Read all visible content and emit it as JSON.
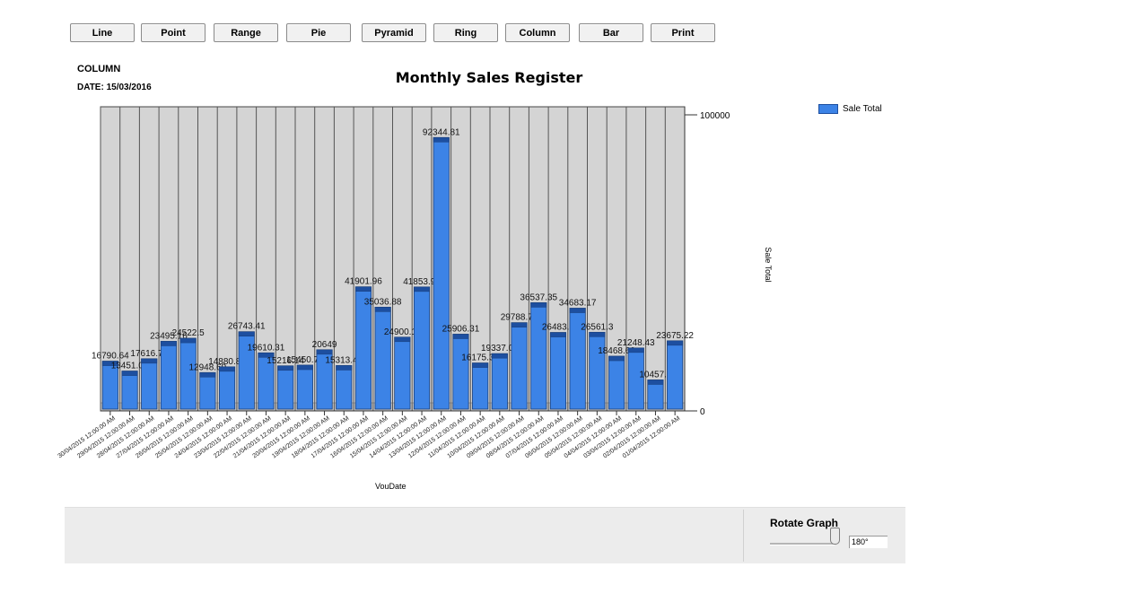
{
  "header": {
    "chart_type_label": "COLUMN",
    "date_label": "DATE: 15/03/2016"
  },
  "legend": {
    "label": "Sale Total",
    "color": "#3c83e6"
  },
  "axis": {
    "x_title": "VouDate",
    "y_title": "Sale Total"
  },
  "controls": {
    "buttons": [
      "Line",
      "Point",
      "Range",
      "Pie",
      "Pyramid",
      "Ring",
      "Column",
      "Bar",
      "Print"
    ],
    "rotate_title": "Rotate Graph",
    "rotate_value": "180°",
    "rotate_level_degrees": 180
  },
  "colors": {
    "bar": "#3c83e6",
    "bar_top": "#1d4fa0",
    "plot_bg": "#d4d4d4",
    "gridline": "#555555"
  },
  "chart_data": {
    "type": "bar",
    "title": "Monthly Sales Register",
    "xlabel": "VouDate",
    "ylabel": "Sale Total",
    "ylim": [
      0,
      100000
    ],
    "y_ticks": [
      0,
      100000
    ],
    "grid": true,
    "legend_position": "top-right",
    "categories": [
      "30/04/2015 12:00:00 AM",
      "29/04/2015 12:00:00 AM",
      "28/04/2015 12:00:00 AM",
      "27/04/2015 12:00:00 AM",
      "26/04/2015 12:00:00 AM",
      "25/04/2015 12:00:00 AM",
      "24/04/2015 12:00:00 AM",
      "23/04/2015 12:00:00 AM",
      "22/04/2015 12:00:00 AM",
      "21/04/2015 12:00:00 AM",
      "20/04/2015 12:00:00 AM",
      "19/04/2015 12:00:00 AM",
      "18/04/2015 12:00:00 AM",
      "17/04/2015 12:00:00 AM",
      "16/04/2015 12:00:00 AM",
      "15/04/2015 12:00:00 AM",
      "14/04/2015 12:00:00 AM",
      "13/04/2015 12:00:00 AM",
      "12/04/2015 12:00:00 AM",
      "11/04/2015 12:00:00 AM",
      "10/04/2015 12:00:00 AM",
      "09/04/2015 12:00:00 AM",
      "08/04/2015 12:00:00 AM",
      "07/04/2015 12:00:00 AM",
      "06/04/2015 12:00:00 AM",
      "05/04/2015 12:00:00 AM",
      "04/04/2015 12:00:00 AM",
      "03/04/2015 12:00:00 AM",
      "02/04/2015 12:00:00 AM",
      "01/04/2015 12:00:00 AM"
    ],
    "series": [
      {
        "name": "Sale Total",
        "values": [
          16790.64,
          13451.05,
          17616.77,
          23495.16,
          24522.5,
          12948.69,
          14880.89,
          26743.41,
          19610.31,
          15216.14,
          15450.73,
          20649,
          15313.41,
          41901.96,
          35036.88,
          24900.11,
          41853.93,
          92344.81,
          25906.31,
          16175.31,
          19337.09,
          29788.71,
          36537.35,
          26483.8,
          34683.17,
          26561.3,
          18468.69,
          21248.43,
          10457.7,
          23675.22
        ]
      }
    ]
  }
}
